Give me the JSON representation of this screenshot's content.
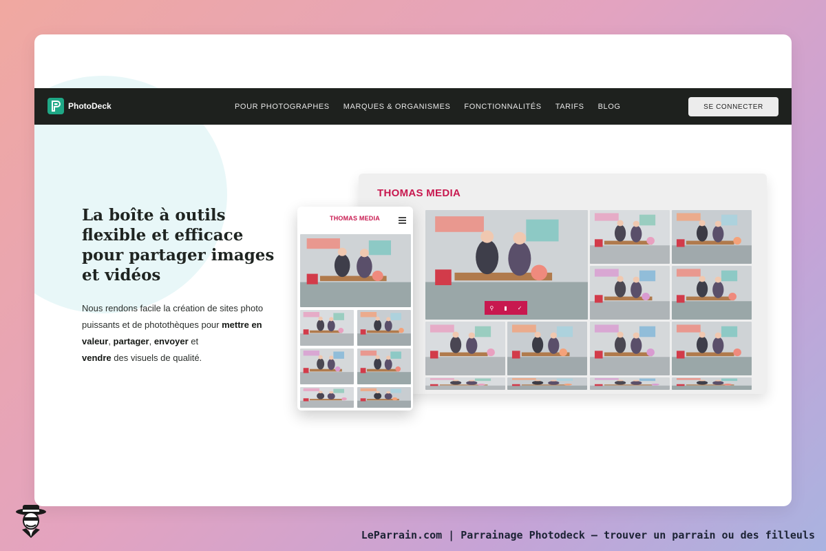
{
  "brand": {
    "logo_text": "PhotoDeck",
    "accent": "#1fa886",
    "gallery_accent": "#c8184f"
  },
  "nav": {
    "links": [
      "POUR PHOTOGRAPHES",
      "MARQUES & ORGANISMES",
      "FONCTIONNALITÉS",
      "TARIFS",
      "BLOG"
    ],
    "login_label": "SE CONNECTER"
  },
  "hero": {
    "title": "La boîte à outils flexible et efficace pour partager images et vidéos",
    "desc_1": "Nous rendons facile la création de sites photo puissants et de photothèques pour ",
    "desc_b1": "mettre en valeur",
    "desc_2": ", ",
    "desc_b2": "partager",
    "desc_3": ", ",
    "desc_b3": "envoyer",
    "desc_4": " et ",
    "desc_b4": "vendre",
    "desc_5": " des visuels de qualité."
  },
  "gallery": {
    "desktop_title": "THOMAS MEDIA",
    "mobile_title": "THOMAS MEDIA",
    "action_icons": [
      "search-icon",
      "cart-icon",
      "check-icon"
    ]
  },
  "footer": {
    "caption": "LeParrain.com | Parrainage Photodeck — trouver un parrain ou des filleuls"
  }
}
